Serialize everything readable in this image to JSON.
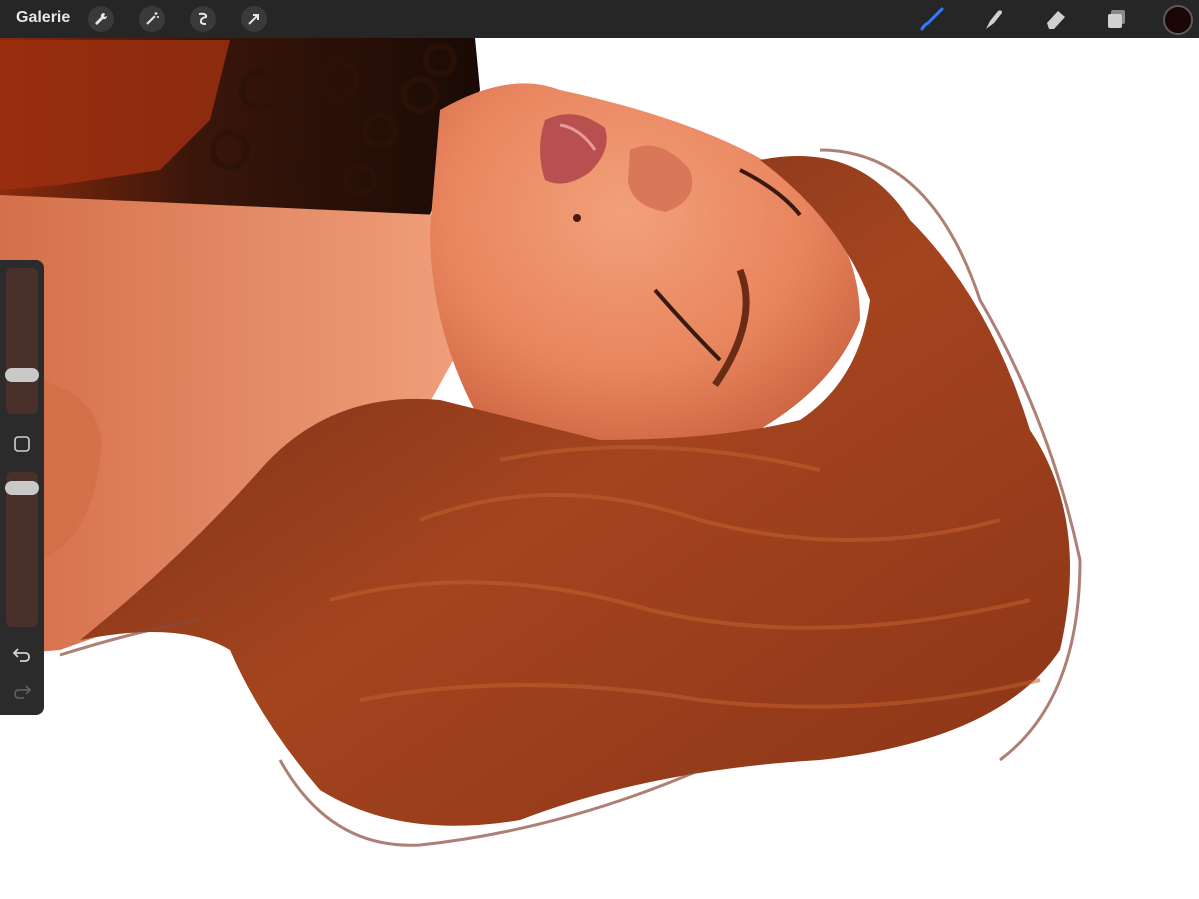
{
  "topbar": {
    "gallery_label": "Galerie",
    "left_tools": [
      "wrench-icon",
      "magic-wand-icon",
      "selection-icon",
      "transform-arrow-icon"
    ],
    "right_tools": [
      "brush-icon",
      "smudge-icon",
      "eraser-icon",
      "layers-icon"
    ],
    "active_tool": "brush-icon",
    "active_color": "#1a0604",
    "accent": "#2f7bff"
  },
  "sidebar": {
    "brush_size_level": 0.35,
    "opacity_level": 0.95
  }
}
